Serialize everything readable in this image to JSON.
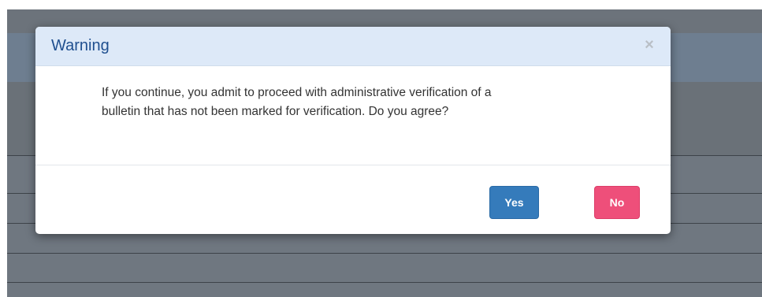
{
  "dialog": {
    "title": "Warning",
    "close_symbol": "×",
    "close_icon": "close-icon",
    "message_line1": "If you continue, you admit to proceed with administrative verification of a",
    "message_line2": "bulletin that has not been marked for verification. Do you agree?",
    "yes_label": "Yes",
    "no_label": "No"
  },
  "colors": {
    "header_bg": "#dde9f8",
    "title": "#1f4f8f",
    "yes_button": "#357bbb",
    "no_button": "#ee4f7a",
    "backdrop": "#6f7780"
  }
}
